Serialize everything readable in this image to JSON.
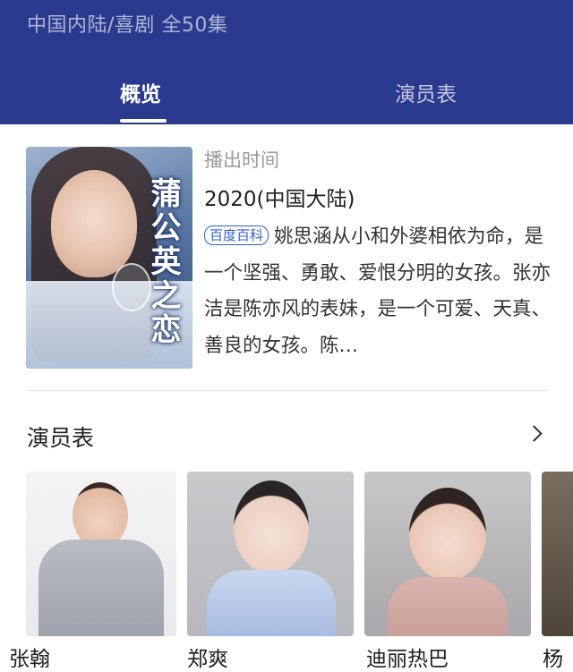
{
  "header": {
    "meta": "中国内陆/喜剧 全50集",
    "tabs": [
      {
        "label": "概览",
        "active": true
      },
      {
        "label": "演员表",
        "active": false
      }
    ],
    "color": "#2a3a8f"
  },
  "overview": {
    "poster_title": "蒲公英之恋",
    "air_label": "播出时间",
    "air_value": "2020(中国大陆)",
    "badge": "百度百科",
    "synopsis": "姚思涵从小和外婆相依为命，是一个坚强、勇敢、爱恨分明的女孩。张亦洁是陈亦风的表妹，是一个可爱、天真、善良的女孩。陈…"
  },
  "cast_section": {
    "title": "演员表",
    "members": [
      {
        "name": "张翰"
      },
      {
        "name": "郑爽"
      },
      {
        "name": "迪丽热巴"
      },
      {
        "name": "杨"
      }
    ]
  }
}
